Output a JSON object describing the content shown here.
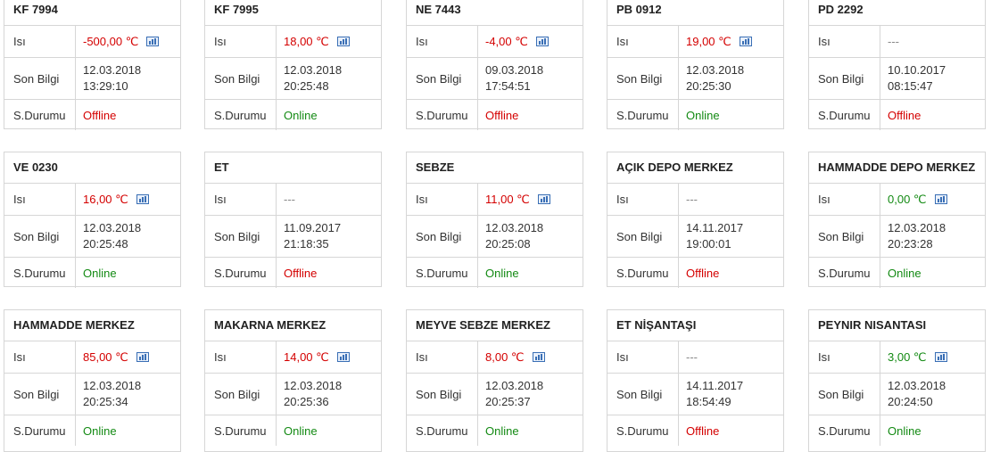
{
  "labels": {
    "temperature": "Isı",
    "last_info": "Son Bilgi",
    "status": "S.Durumu"
  },
  "colors": {
    "red": "#d40000",
    "green": "#138a13",
    "border": "#d6d6d6",
    "chart_icon": "#3a6fb5"
  },
  "cards": [
    {
      "name": "KF 7994",
      "temp": "-500,00 ℃",
      "temp_color": "red",
      "has_chart": true,
      "date": "12.03.2018",
      "time": "13:29:10",
      "status": "Offline"
    },
    {
      "name": "KF 7995",
      "temp": "18,00 ℃",
      "temp_color": "red",
      "has_chart": true,
      "date": "12.03.2018",
      "time": "20:25:48",
      "status": "Online"
    },
    {
      "name": "NE 7443",
      "temp": "-4,00 ℃",
      "temp_color": "red",
      "has_chart": true,
      "date": "09.03.2018",
      "time": "17:54:51",
      "status": "Offline"
    },
    {
      "name": "PB 0912",
      "temp": "19,00 ℃",
      "temp_color": "red",
      "has_chart": true,
      "date": "12.03.2018",
      "time": "20:25:30",
      "status": "Online"
    },
    {
      "name": "PD 2292",
      "temp": "---",
      "temp_color": "none",
      "has_chart": false,
      "date": "10.10.2017",
      "time": "08:15:47",
      "status": "Offline"
    },
    {
      "name": "VE 0230",
      "temp": "16,00 ℃",
      "temp_color": "red",
      "has_chart": true,
      "date": "12.03.2018",
      "time": "20:25:48",
      "status": "Online"
    },
    {
      "name": "ET",
      "temp": "---",
      "temp_color": "none",
      "has_chart": false,
      "date": "11.09.2017",
      "time": "21:18:35",
      "status": "Offline"
    },
    {
      "name": "SEBZE",
      "temp": "11,00 ℃",
      "temp_color": "red",
      "has_chart": true,
      "date": "12.03.2018",
      "time": "20:25:08",
      "status": "Online"
    },
    {
      "name": "AÇIK DEPO MERKEZ",
      "temp": "---",
      "temp_color": "none",
      "has_chart": false,
      "date": "14.11.2017",
      "time": "19:00:01",
      "status": "Offline"
    },
    {
      "name": "HAMMADDE DEPO MERKEZ",
      "temp": "0,00 ℃",
      "temp_color": "green",
      "has_chart": true,
      "date": "12.03.2018",
      "time": "20:23:28",
      "status": "Online"
    },
    {
      "name": "HAMMADDE MERKEZ",
      "temp": "85,00 ℃",
      "temp_color": "red",
      "has_chart": true,
      "date": "12.03.2018",
      "time": "20:25:34",
      "status": "Online"
    },
    {
      "name": "MAKARNA MERKEZ",
      "temp": "14,00 ℃",
      "temp_color": "red",
      "has_chart": true,
      "date": "12.03.2018",
      "time": "20:25:36",
      "status": "Online"
    },
    {
      "name": "MEYVE SEBZE MERKEZ",
      "temp": "8,00 ℃",
      "temp_color": "red",
      "has_chart": true,
      "date": "12.03.2018",
      "time": "20:25:37",
      "status": "Online"
    },
    {
      "name": "ET NİŞANTAŞI",
      "temp": "---",
      "temp_color": "none",
      "has_chart": false,
      "date": "14.11.2017",
      "time": "18:54:49",
      "status": "Offline"
    },
    {
      "name": "PEYNIR NISANTASI",
      "temp": "3,00 ℃",
      "temp_color": "green",
      "has_chart": true,
      "date": "12.03.2018",
      "time": "20:24:50",
      "status": "Online"
    }
  ]
}
